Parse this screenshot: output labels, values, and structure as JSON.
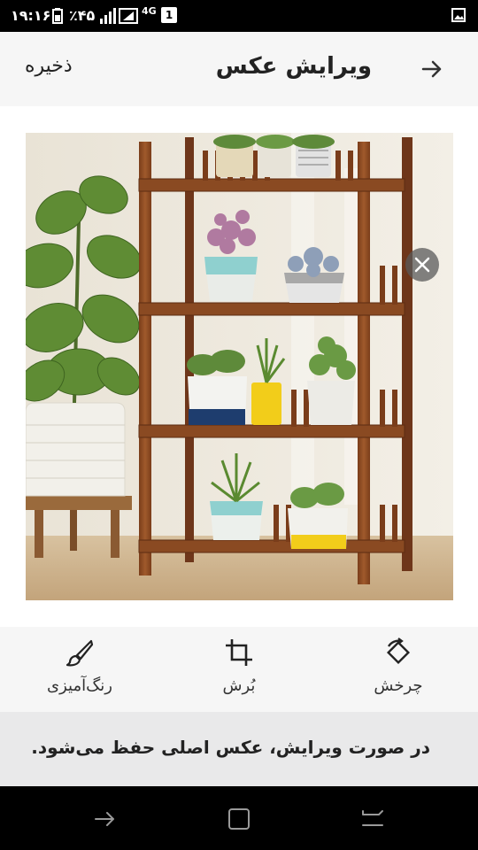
{
  "status_bar": {
    "time": "۱۹:۱۶",
    "battery_percent": "٪۴۵",
    "network": "4G",
    "notification_count": "1"
  },
  "header": {
    "title": "ویرایش عکس",
    "save_label": "ذخیره",
    "back_icon": "arrow-right-icon"
  },
  "photo": {
    "description_icon": "plant-shelf-photo",
    "close_icon": "close-icon"
  },
  "toolbar": {
    "items": [
      {
        "label": "چرخش",
        "icon": "rotate-icon"
      },
      {
        "label": "بُرش",
        "icon": "crop-icon"
      },
      {
        "label": "رنگ‌آمیزی",
        "icon": "brush-icon"
      }
    ]
  },
  "notice": {
    "text": "در صورت ویرایش، عکس اصلی حفظ می‌شود."
  },
  "nav_bar": {
    "buttons": [
      "back-icon",
      "home-icon",
      "recents-icon"
    ]
  },
  "colors": {
    "header_bg": "#f6f6f6",
    "notice_bg": "#e9e9ea",
    "shelf_wood": "#8a4a22",
    "text_dark": "#222222"
  }
}
